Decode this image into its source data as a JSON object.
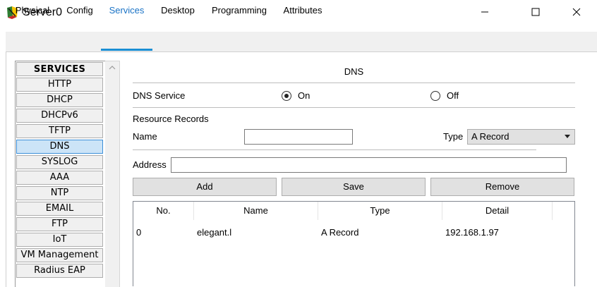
{
  "window": {
    "title": "Server0"
  },
  "tabs": [
    {
      "label": "Physical"
    },
    {
      "label": "Config"
    },
    {
      "label": "Services",
      "active": true
    },
    {
      "label": "Desktop"
    },
    {
      "label": "Programming"
    },
    {
      "label": "Attributes"
    }
  ],
  "services": {
    "header": "SERVICES",
    "items": [
      "HTTP",
      "DHCP",
      "DHCPv6",
      "TFTP",
      "DNS",
      "SYSLOG",
      "AAA",
      "NTP",
      "EMAIL",
      "FTP",
      "IoT",
      "VM Management",
      "Radius EAP"
    ],
    "selected": "DNS"
  },
  "dns": {
    "title": "DNS",
    "service_label": "DNS Service",
    "on_label": "On",
    "off_label": "Off",
    "service_state": "On",
    "resource_records_label": "Resource Records",
    "name_label": "Name",
    "name_value": "",
    "type_label": "Type",
    "type_value": "A Record",
    "address_label": "Address",
    "address_value": "",
    "buttons": {
      "add": "Add",
      "save": "Save",
      "remove": "Remove"
    },
    "table": {
      "columns": [
        "No.",
        "Name",
        "Type",
        "Detail"
      ],
      "rows": [
        {
          "no": "0",
          "name": "elegant.l",
          "type": "A Record",
          "detail": "192.168.1.97"
        }
      ]
    }
  },
  "colors": {
    "accent": "#1b8fd4",
    "selected_bg": "#cce4f7",
    "selected_border": "#3c8fd8"
  },
  "icons": {
    "app": "packet-tracer-server-icon",
    "minimize": "minimize-icon",
    "maximize": "maximize-icon",
    "close": "close-icon",
    "scroll_up": "chevron-up-icon",
    "dropdown": "chevron-down-icon"
  }
}
